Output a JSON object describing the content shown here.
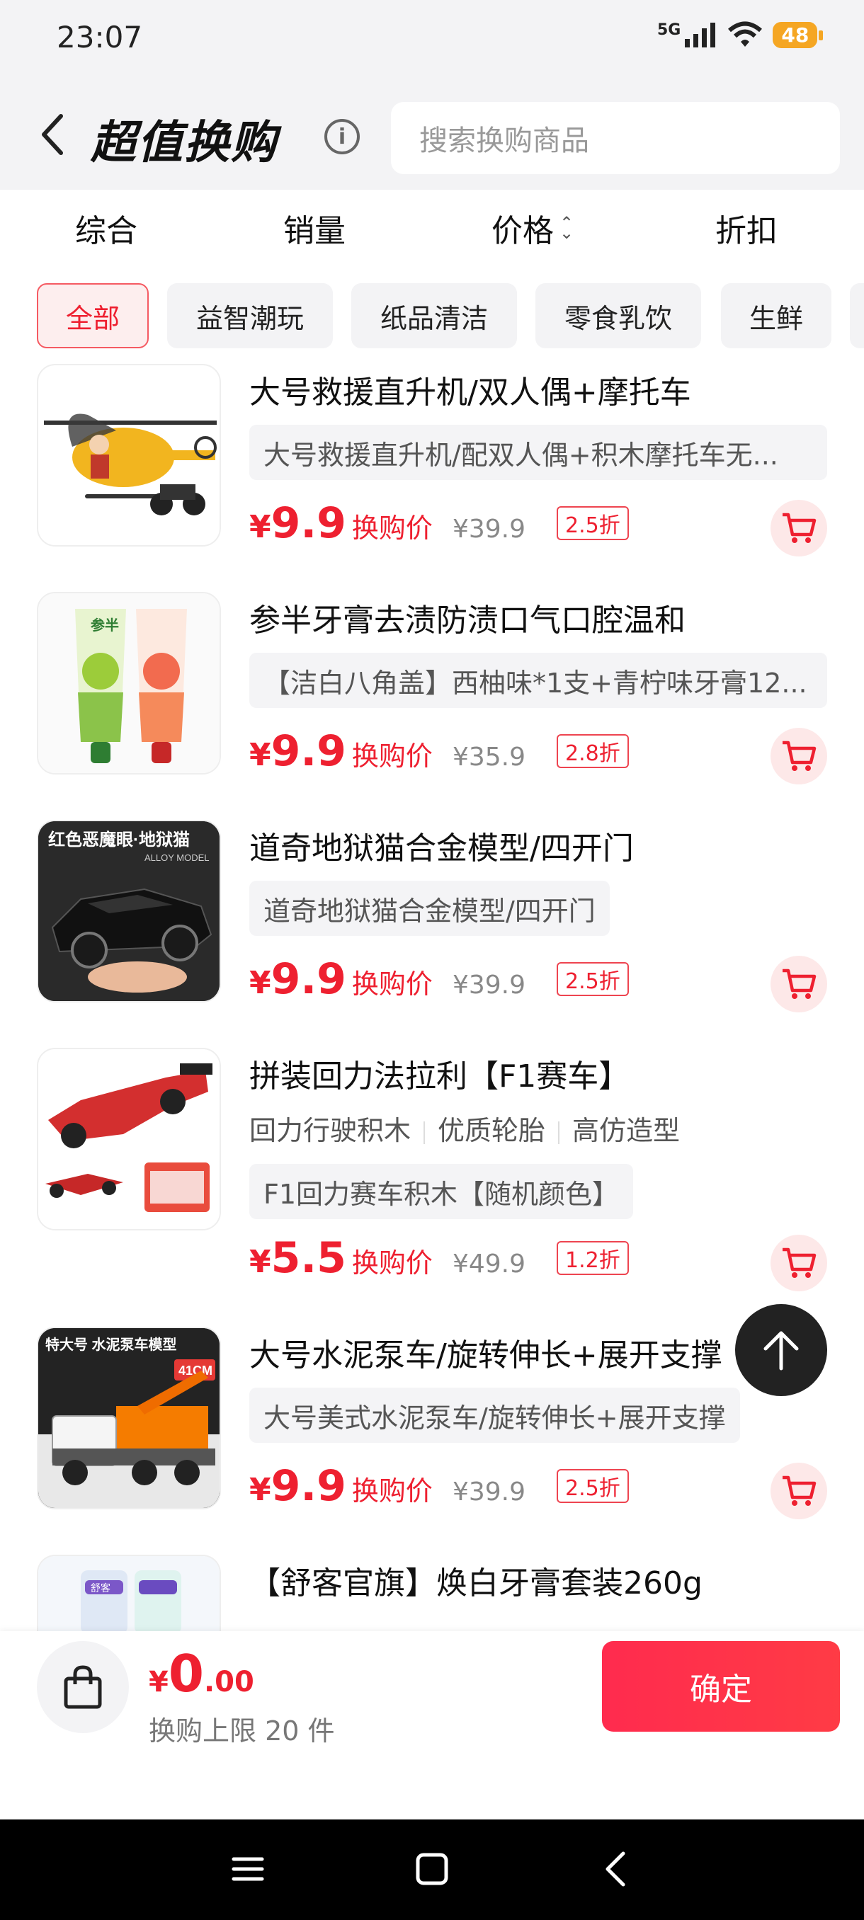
{
  "status": {
    "time": "23:07",
    "network": "5G",
    "battery": "48"
  },
  "header": {
    "title": "超值换购",
    "info_glyph": "i",
    "search_placeholder": "搜索换购商品"
  },
  "sort_tabs": {
    "comprehensive": "综合",
    "sales": "销量",
    "price": "价格",
    "discount": "折扣"
  },
  "categories": [
    "全部",
    "益智潮玩",
    "纸品清洁",
    "零食乳饮",
    "生鲜"
  ],
  "active_category": "全部",
  "products": [
    {
      "title": "大号救援直升机/双人偶+摩托车",
      "spec": "大号救援直升机/配双人偶+积木摩托车无...",
      "currency": "¥",
      "price": "9.9",
      "price_label": "换购价",
      "original": "¥39.9",
      "discount": "2.5折"
    },
    {
      "title": "参半牙膏去渍防渍口气口腔温和",
      "spec": "【洁白八角盖】西柚味*1支+青柠味牙膏12...",
      "currency": "¥",
      "price": "9.9",
      "price_label": "换购价",
      "original": "¥35.9",
      "discount": "2.8折"
    },
    {
      "title": "道奇地狱猫合金模型/四开门",
      "spec": "道奇地狱猫合金模型/四开门",
      "currency": "¥",
      "price": "9.9",
      "price_label": "换购价",
      "original": "¥39.9",
      "discount": "2.5折"
    },
    {
      "title": "拼装回力法拉利【F1赛车】",
      "tags": [
        "回力行驶积木",
        "优质轮胎",
        "高仿造型"
      ],
      "spec": "F1回力赛车积木【随机颜色】",
      "currency": "¥",
      "price": "5.5",
      "price_label": "换购价",
      "original": "¥49.9",
      "discount": "1.2折"
    },
    {
      "title": "大号水泥泵车/旋转伸长+展开支撑",
      "spec": "大号美式水泥泵车/旋转伸长+展开支撑",
      "currency": "¥",
      "price": "9.9",
      "price_label": "换购价",
      "original": "¥39.9",
      "discount": "2.5折"
    },
    {
      "title": "【舒客官旗】焕白牙膏套装260g"
    }
  ],
  "image_text": {
    "car_banner": "红色恶魔眼·地狱猫",
    "car_sub": "ALLOY MODEL",
    "truck_banner": "特大号 水泥泵车模型",
    "truck_size": "41CM",
    "toothpaste_brand": "参半",
    "shuke_brand": "舒客"
  },
  "bottom": {
    "currency": "¥",
    "total_int": "0",
    "total_dec": ".00",
    "limit": "换购上限 20 件",
    "confirm": "确定"
  },
  "colors": {
    "accent": "#ee2030",
    "confirm_bg": "#ff2b4e",
    "active_cat_bg": "#fdeeee"
  }
}
